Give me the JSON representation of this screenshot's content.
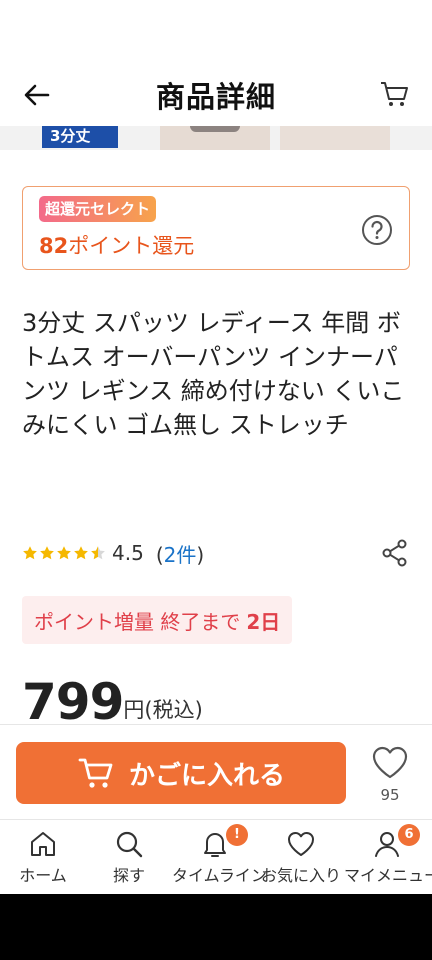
{
  "header": {
    "title": "商品詳細"
  },
  "hero": {
    "badge": "3分丈"
  },
  "point_box": {
    "tag": "超還元セレクト",
    "points": "82",
    "points_suffix": "ポイント還元"
  },
  "product": {
    "title": "3分丈 スパッツ レディース 年間 ボトムス オーバーパンツ インナーパンツ レギンス 締め付けない くいこみにくい ゴム無し ストレッチ"
  },
  "rating": {
    "stars": 4.5,
    "value": "4.5",
    "open": "(",
    "count": "2件",
    "close": ")"
  },
  "promo": {
    "text": "ポイント増量 終了まで",
    "days": "2日"
  },
  "price": {
    "amount": "799",
    "unit": "円(税込)"
  },
  "buy_bar": {
    "add_to_cart": "かごに入れる",
    "favorite_count": "95"
  },
  "tabbar": {
    "items": [
      {
        "label": "ホーム",
        "icon": "home-icon"
      },
      {
        "label": "探す",
        "icon": "search-icon"
      },
      {
        "label": "タイムライン",
        "icon": "bell-icon",
        "badge": "!"
      },
      {
        "label": "お気に入り",
        "icon": "heart-icon"
      },
      {
        "label": "マイメニュー",
        "icon": "person-icon",
        "badge": "6"
      }
    ]
  },
  "colors": {
    "accent": "#f07035",
    "link": "#1a73c8",
    "promo": "#e0404a",
    "star": "#f5b800"
  }
}
